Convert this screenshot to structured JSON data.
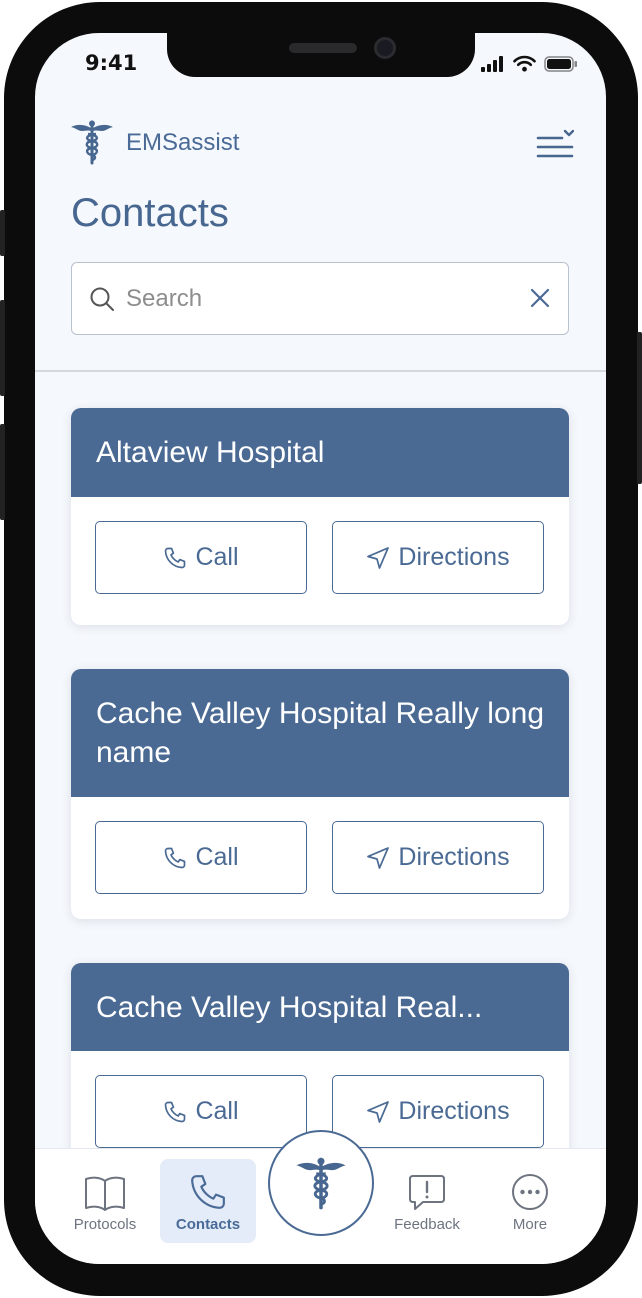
{
  "status_bar": {
    "time": "9:41"
  },
  "header": {
    "brand": "EMSassist"
  },
  "page": {
    "title": "Contacts"
  },
  "search": {
    "placeholder": "Search",
    "value": ""
  },
  "contacts": [
    {
      "name": "Altaview Hospital",
      "call_label": "Call",
      "directions_label": "Directions"
    },
    {
      "name": "Cache Valley Hospital Really long name",
      "call_label": "Call",
      "directions_label": "Directions"
    },
    {
      "name": "Cache Valley Hospital Real...",
      "call_label": "Call",
      "directions_label": "Directions"
    }
  ],
  "tabbar": {
    "items": [
      {
        "label": "Protocols",
        "icon": "book-icon"
      },
      {
        "label": "Contacts",
        "icon": "phone-icon",
        "active": true
      },
      {
        "label": "Feedback",
        "icon": "feedback-icon"
      },
      {
        "label": "More",
        "icon": "more-icon"
      }
    ],
    "center_icon": "caduceus-icon"
  },
  "colors": {
    "accent": "#4a6a94",
    "background": "#f5f8fc",
    "active_tab_bg": "#e3ecf8"
  }
}
